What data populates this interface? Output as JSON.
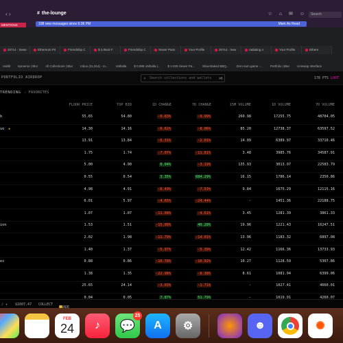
{
  "slack": {
    "channel": "the-lounge",
    "new_messages": "108 new messages since 6:36 PM",
    "mark_read": "Mark As Read",
    "search_placeholder": "Search",
    "left_tab": "MENTIONS"
  },
  "browser": {
    "tabs": [
      "20714 - Sewe",
      "Ethereum Pri",
      "Friendship C",
      "$ 2,0543 F",
      "Friendship C",
      "Sewer Pass",
      "Your Profile",
      "20714 - Sew",
      "radiating o",
      "Your Profile",
      "Ethere"
    ],
    "bookmarks": [
      "reddit",
      "kprverse | Blur",
      "All Collections | Blur",
      "Inbox (21,814) - m...",
      "Valhalla",
      "$ 0.995 Valhalla |...",
      "$ 2.029 Sewer Pa...",
      "Slow-Baked BBQ...",
      "Zero-sum game -...",
      "Portfolio | Blur",
      "Uniswap Interface"
    ]
  },
  "app": {
    "nav": "PORTFOLIO  AIRDROP",
    "search_placeholder": "Search collections and wallets",
    "search_shortcut": "⌘K",
    "points_label": "178 PTS",
    "points_accent": "LOOT",
    "tab_trending": "TRENDING",
    "tab_favorites": "FAVORITES"
  },
  "table": {
    "headers": [
      "FLOOR PRICE",
      "TOP BID",
      "1D CHANGE",
      "7D CHANGE",
      "15M VOLUME",
      "1D VOLUME",
      "7D VOLUME"
    ],
    "rows": [
      {
        "name": "b",
        "star": false,
        "floor": "55.65",
        "bid": "54.80",
        "c1": "-0.83%",
        "c7": "-9.99%",
        "v15": "260.98",
        "v1": "17255.75",
        "v7": "48784.05"
      },
      {
        "name": "uo",
        "star": true,
        "floor": "14.30",
        "bid": "14.16",
        "c1": "-0.62%",
        "c7": "-8.06%",
        "v15": "85.20",
        "v1": "12738.37",
        "v7": "63597.52"
      },
      {
        "name": "",
        "star": false,
        "floor": "13.91",
        "bid": "13.84",
        "c1": "-6.31%",
        "c7": "-2.01%",
        "v15": "14.09",
        "v1": "6389.97",
        "v7": "33710.46"
      },
      {
        "name": "",
        "star": false,
        "floor": "1.75",
        "bid": "1.74",
        "c1": "-7.07%",
        "c7": "-11.81%",
        "v15": "3.48",
        "v1": "3985.76",
        "v7": "34587.91"
      },
      {
        "name": "",
        "star": false,
        "floor": "5.00",
        "bid": "4.90",
        "c1": "0.04%",
        "c7": "-3.19%",
        "v15": "135.93",
        "v1": "3013.97",
        "v7": "22583.79"
      },
      {
        "name": "",
        "star": false,
        "floor": "0.55",
        "bid": "0.54",
        "c1": "3.35%",
        "c7": "684.29%",
        "v15": "16.15",
        "v1": "1786.14",
        "v7": "2350.86"
      },
      {
        "name": "",
        "star": false,
        "floor": "4.98",
        "bid": "4.91",
        "c1": "-6.49%",
        "c7": "-7.53%",
        "v15": "9.84",
        "v1": "1675.29",
        "v7": "12115.16"
      },
      {
        "name": "",
        "star": false,
        "floor": "6.01",
        "bid": "5.97",
        "c1": "-4.65%",
        "c7": "-24.44%",
        "v15": "-",
        "v1": "1451.36",
        "v7": "22188.75"
      },
      {
        "name": "",
        "star": false,
        "floor": "1.07",
        "bid": "1.07",
        "c1": "-11.08%",
        "c7": "-4.61%",
        "v15": "3.45",
        "v1": "1281.39",
        "v7": "3861.33"
      },
      {
        "name": "ion",
        "star": false,
        "floor": "1.53",
        "bid": "1.51",
        "c1": "-15.08%",
        "c7": "40.28%",
        "v15": "19.96",
        "v1": "1221.43",
        "v7": "16247.51"
      },
      {
        "name": "",
        "star": false,
        "floor": "2.02",
        "bid": "1.98",
        "c1": "-11.79%",
        "c7": "-14.01%",
        "v15": "13.96",
        "v1": "1183.32",
        "v7": "6897.08"
      },
      {
        "name": "",
        "star": false,
        "floor": "1.40",
        "bid": "1.37",
        "c1": "-5.97%",
        "c7": "-5.39%",
        "v15": "12.42",
        "v1": "1166.36",
        "v7": "13733.93"
      },
      {
        "name": "es",
        "star": false,
        "floor": "0.88",
        "bid": "0.86",
        "c1": "-10.78%",
        "c7": "-10.02%",
        "v15": "10.27",
        "v1": "1128.59",
        "v7": "5307.86"
      },
      {
        "name": "",
        "star": false,
        "floor": "1.38",
        "bid": "1.35",
        "c1": "-22.98%",
        "c7": "-8.38%",
        "v15": "8.61",
        "v1": "1081.94",
        "v7": "6399.06"
      },
      {
        "name": "",
        "star": false,
        "floor": "25.65",
        "bid": "24.14",
        "c1": "-3.03%",
        "c7": "-1.71%",
        "v15": "-",
        "v1": "1027.41",
        "v7": "4660.01"
      },
      {
        "name": "",
        "star": false,
        "floor": "0.04",
        "bid": "0.05",
        "c1": "7.87%",
        "c7": "51.79%",
        "v15": "-",
        "v1": "1019.91",
        "v7": "4260.07"
      }
    ]
  },
  "footer": {
    "price": "$1607.47",
    "collect": "COLLECT",
    "trade": "TRADE"
  },
  "dock": {
    "calendar_month": "FEB",
    "calendar_day": "24",
    "messages_badge": "25"
  },
  "colors": {
    "negative": "#ff5a3d",
    "positive": "#5ee872",
    "accent": "#f0c"
  }
}
